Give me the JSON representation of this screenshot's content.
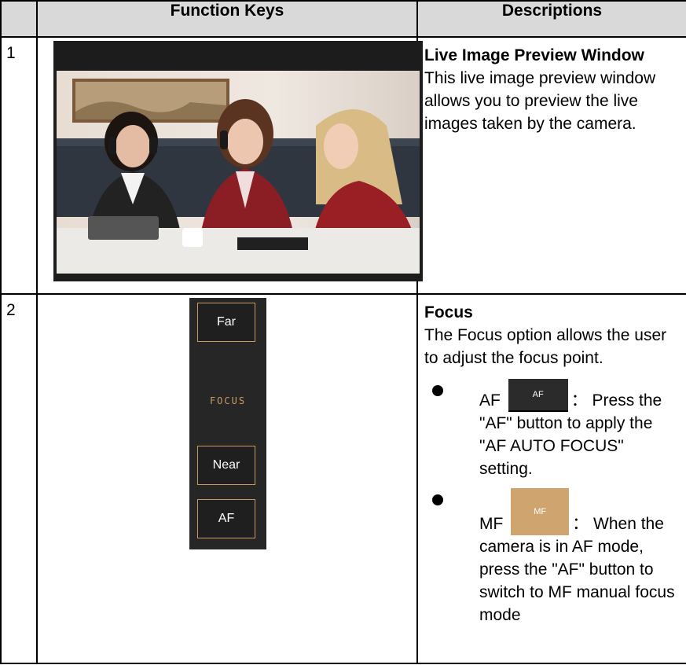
{
  "table": {
    "header_col2": "Function Keys",
    "header_col3": "Descriptions"
  },
  "row1": {
    "number": "1",
    "title": "Live Image Preview Window",
    "body": "This live image preview window allows you to preview the live images taken by the camera."
  },
  "row2": {
    "number": "2",
    "panel": {
      "far_label": "Far",
      "focus_label": "FOCUS",
      "near_label": "Near",
      "af_label": "AF"
    },
    "title": "Focus",
    "body": "The Focus option allows the user to adjust the focus point.",
    "bullets": [
      {
        "prefix": "AF",
        "button_label": "AF",
        "text": "Press the \"AF\" button to apply the \"AF AUTO FOCUS\" setting."
      },
      {
        "prefix": "MF",
        "button_label": "MF",
        "text": "When the camera is in AF mode, press the \"AF\" button to switch to MF manual focus mode"
      }
    ]
  },
  "colors": {
    "header_bg": "#d9d9d9",
    "panel_bg": "#262626",
    "accent_gold": "#c89b62",
    "mf_button": "#d0a46f"
  }
}
